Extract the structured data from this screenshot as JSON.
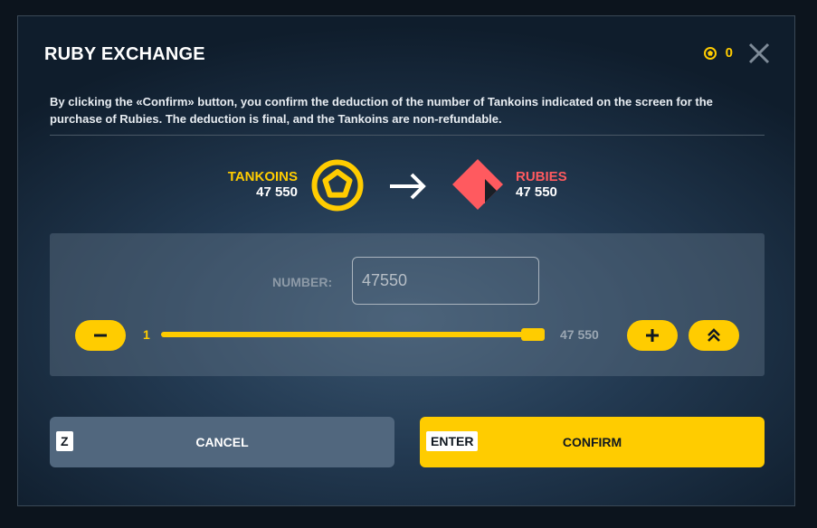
{
  "dialog": {
    "title": "RUBY EXCHANGE",
    "balance": "0",
    "description": "By clicking the «Confirm» button, you confirm the deduction of the number of Tankoins indicated on the screen for the purchase of Rubies. The deduction is final, and the Tankoins are non-refundable."
  },
  "exchange": {
    "from_name": "TANKOINS",
    "from_value": "47 550",
    "to_name": "RUBIES",
    "to_value": "47 550"
  },
  "amount": {
    "label": "NUMBER:",
    "value": "47550",
    "min_label": "1",
    "max_label": "47 550",
    "slider_fraction": 1.0
  },
  "buttons": {
    "cancel_key": "Z",
    "cancel_label": "CANCEL",
    "confirm_key": "ENTER",
    "confirm_label": "CONFIRM"
  },
  "colors": {
    "accent": "#ffcc00",
    "ruby": "#ff5a5f",
    "text": "#ffffff"
  },
  "icons": [
    "coin-icon",
    "close-icon",
    "tankoin-icon",
    "arrow-right-icon",
    "ruby-icon",
    "minus-icon",
    "plus-icon",
    "double-chevron-up-icon"
  ]
}
